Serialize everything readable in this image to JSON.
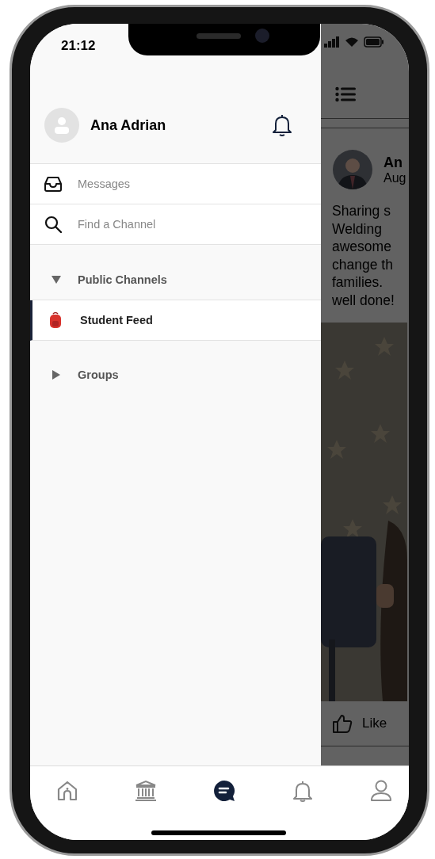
{
  "status_bar": {
    "time": "21:12"
  },
  "drawer": {
    "user": {
      "name": "Ana Adrian"
    },
    "nav_items": [
      {
        "kind": "inbox",
        "label": "Messages"
      },
      {
        "kind": "search",
        "label": "Find a Channel"
      }
    ],
    "sections": [
      {
        "title": "Public Channels",
        "expanded": true,
        "channels": [
          {
            "name": "Student Feed",
            "selected": true
          }
        ]
      },
      {
        "title": "Groups",
        "expanded": false
      }
    ]
  },
  "feed": {
    "post": {
      "author": "An",
      "date": "Aug",
      "text_lines": [
        "Sharing s",
        "Welding",
        "awesome",
        "change th",
        "families.",
        "well done!"
      ]
    },
    "actions": [
      {
        "label": "Like"
      }
    ]
  },
  "tab_bar": [
    {
      "kind": "home",
      "selected": false
    },
    {
      "kind": "bank",
      "selected": false
    },
    {
      "kind": "chat",
      "selected": true
    },
    {
      "kind": "bell",
      "selected": false
    },
    {
      "kind": "profile",
      "selected": false
    }
  ]
}
